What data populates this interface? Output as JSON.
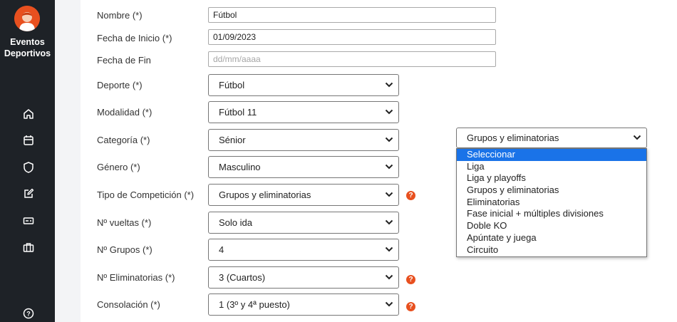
{
  "sidebar": {
    "brand_line1": "Eventos",
    "brand_line2": "Deportivos",
    "items": [
      {
        "icon": "home-icon"
      },
      {
        "icon": "calendar-icon"
      },
      {
        "icon": "shield-icon"
      },
      {
        "icon": "edit-icon"
      },
      {
        "icon": "ticket-icon"
      },
      {
        "icon": "briefcase-icon"
      }
    ],
    "help_icon": "help-circle-icon"
  },
  "form": {
    "nombre": {
      "label": "Nombre (*)",
      "value": "Fútbol"
    },
    "fecha_inicio": {
      "label": "Fecha de Inicio (*)",
      "value": "01/09/2023"
    },
    "fecha_fin": {
      "label": "Fecha de Fin",
      "placeholder": "dd/mm/aaaa"
    },
    "deporte": {
      "label": "Deporte (*)",
      "value": "Fútbol"
    },
    "modalidad": {
      "label": "Modalidad (*)",
      "value": "Fútbol 11"
    },
    "categoria": {
      "label": "Categoría (*)",
      "value": "Sénior"
    },
    "genero": {
      "label": "Género (*)",
      "value": "Masculino"
    },
    "tipo_competicion": {
      "label": "Tipo de Competición (*)",
      "value": "Grupos y eliminatorias"
    },
    "vueltas": {
      "label": "Nº vueltas (*)",
      "value": "Solo ida"
    },
    "grupos": {
      "label": "Nº Grupos (*)",
      "value": "4"
    },
    "eliminatorias": {
      "label": "Nº Eliminatorias (*)",
      "value": "3 (Cuartos)"
    },
    "consolacion": {
      "label": "Consolación (*)",
      "value": "1 (3º y 4ª puesto)"
    },
    "help_glyph": "?"
  },
  "dropdown": {
    "value": "Grupos y eliminatorias",
    "highlighted_index": 0,
    "options": [
      "Seleccionar",
      "Liga",
      "Liga y playoffs",
      "Grupos y eliminatorias",
      "Eliminatorias",
      "Fase inicial + múltiples divisiones",
      "Doble KO",
      "Apúntate y juega",
      "Circuito"
    ]
  },
  "colors": {
    "accent": "#e8501f",
    "sidebar": "#1e2227",
    "highlight": "#1a73e8"
  }
}
